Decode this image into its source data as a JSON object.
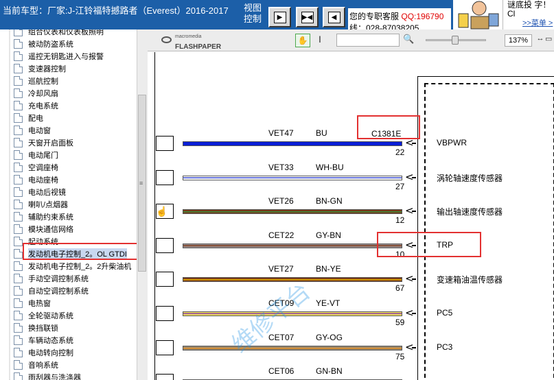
{
  "header": {
    "car_title": "当前车型：厂家:J-江铃福特撼路者（Everest）2016-2017",
    "view_control": "视图控制",
    "nav_prev": "◀",
    "nav_fit": "▶◀",
    "nav_next": "◀",
    "service_text": "您的专职客服",
    "service_qq": "QQ:196790",
    "service_tel": "线：028-87038205",
    "mascot_text": "谜底投 字！  Cl",
    "mascot_link": ">>菜单 >"
  },
  "tree": {
    "items": [
      {
        "label": "组合仪表和仪表板照明"
      },
      {
        "label": "被动防盗系统"
      },
      {
        "label": "遥控无钥匙进入与报警"
      },
      {
        "label": "变速器控制"
      },
      {
        "label": "巡航控制"
      },
      {
        "label": "冷却风扇"
      },
      {
        "label": "充电系统"
      },
      {
        "label": "配电"
      },
      {
        "label": "电动窗"
      },
      {
        "label": "天窗开启面板"
      },
      {
        "label": "电动尾门"
      },
      {
        "label": "空调座椅"
      },
      {
        "label": "电动座椅"
      },
      {
        "label": "电动后视镜"
      },
      {
        "label": "喇叭/点烟器"
      },
      {
        "label": "辅助约束系统"
      },
      {
        "label": "模块通信网络"
      },
      {
        "label": "起动系统"
      },
      {
        "label": "发动机电子控制_2。OL GTDI"
      },
      {
        "label": "发动机电子控制_2。2升柴油机"
      },
      {
        "label": "手动空调控制系统"
      },
      {
        "label": "自动空调控制系统"
      },
      {
        "label": "电热窗"
      },
      {
        "label": "全轮驱动系统"
      },
      {
        "label": "换挡联锁"
      },
      {
        "label": "车辆动态系统"
      },
      {
        "label": "电动转向控制"
      },
      {
        "label": "音响系统"
      },
      {
        "label": "雨刮器与洗涤器"
      }
    ],
    "scroll_grip": "≡"
  },
  "toolbar": {
    "logo_brand": "macromedia",
    "logo_product": "FLASHPAPER",
    "hand_tool": "✋",
    "text_tool": "I",
    "search_value": "",
    "search_icon": "🔍",
    "zoom_value": "137%",
    "fit_width": "↔",
    "fit_page": "▭"
  },
  "diagram": {
    "connector_label": "C1381E",
    "wires": [
      {
        "code": "VET47",
        "color": "BU",
        "pin": "22",
        "signal": "VBPWR",
        "hex_main": "#0a1fd6",
        "hex_stripe": "#0a1fd6"
      },
      {
        "code": "VET33",
        "color": "WH-BU",
        "pin": "27",
        "signal": "涡轮轴速度传感器",
        "hex_main": "#ffffff",
        "hex_stripe": "#3344cc"
      },
      {
        "code": "VET26",
        "color": "BN-GN",
        "pin": "12",
        "signal": "输出轴速度传感器",
        "hex_main": "#7a3b1a",
        "hex_stripe": "#3a8a3a"
      },
      {
        "code": "CET22",
        "color": "GY-BN",
        "pin": "10",
        "signal": "TRP",
        "hex_main": "#9a8a8a",
        "hex_stripe": "#7a3b1a"
      },
      {
        "code": "VET27",
        "color": "BN-YE",
        "pin": "67",
        "signal": "变速箱油温传感器",
        "hex_main": "#7a3b1a",
        "hex_stripe": "#e8b000"
      },
      {
        "code": "CET09",
        "color": "YE-VT",
        "pin": "59",
        "signal": "PC5",
        "hex_main": "#f0e060",
        "hex_stripe": "#8a3aa0"
      },
      {
        "code": "CET07",
        "color": "GY-OG",
        "pin": "75",
        "signal": "PC3",
        "hex_main": "#9a8a70",
        "hex_stripe": "#e08a20"
      },
      {
        "code": "CET06",
        "color": "GN-BN",
        "pin": "",
        "signal": "",
        "hex_main": "#2e8a2e",
        "hex_stripe": "#7a3b1a"
      }
    ],
    "watermark": "维修平台"
  }
}
